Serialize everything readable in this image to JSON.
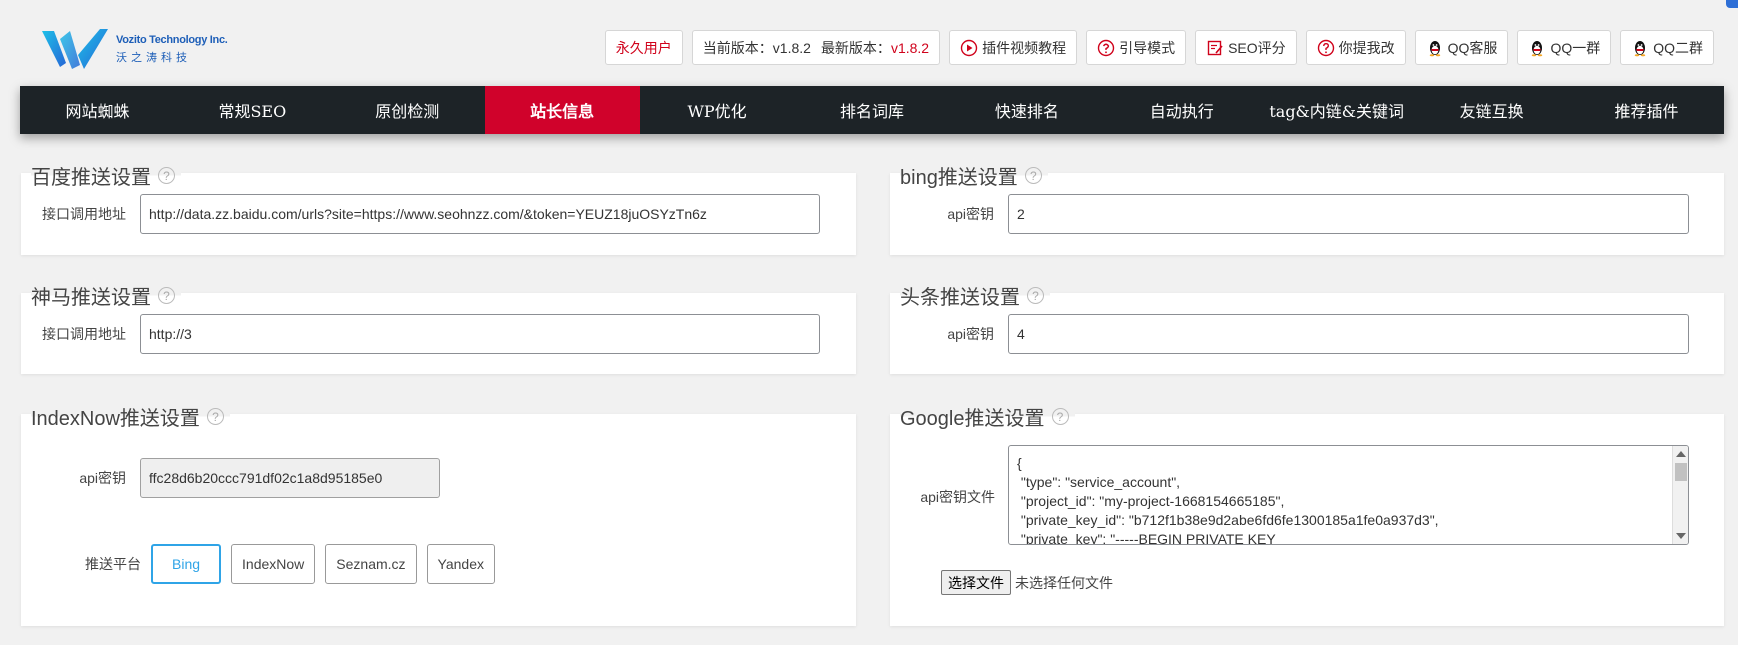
{
  "logo": {
    "name_en": "Vozito Technology Inc.",
    "name_cn": "沃之涛科技"
  },
  "topbar": {
    "license": "永久用户",
    "version_label": "当前版本：v1.8.2",
    "latest_label": "最新版本：",
    "latest_value": "v1.8.2",
    "video_tutorial": "插件视频教程",
    "guide_mode": "引导模式",
    "seo_score": "SEO评分",
    "feedback": "你提我改",
    "qq_service": "QQ客服",
    "qq_group1": "QQ一群",
    "qq_group2": "QQ二群"
  },
  "nav": [
    {
      "label": "网站蜘蛛"
    },
    {
      "label": "常规SEO"
    },
    {
      "label": "原创检测"
    },
    {
      "label": "站长信息",
      "active": true
    },
    {
      "label": "WP优化"
    },
    {
      "label": "排名词库"
    },
    {
      "label": "快速排名"
    },
    {
      "label": "自动执行"
    },
    {
      "label": "tag&内链&关键词"
    },
    {
      "label": "友链互换"
    },
    {
      "label": "推荐插件"
    }
  ],
  "baidu": {
    "title": "百度推送设置",
    "label": "接口调用地址",
    "value": "http://data.zz.baidu.com/urls?site=https://www.seohnzz.com/&token=YEUZ18juOSYzTn6z"
  },
  "bing": {
    "title": "bing推送设置",
    "label": "api密钥",
    "value": "2"
  },
  "shenma": {
    "title": "神马推送设置",
    "label": "接口调用地址",
    "value": "http://3"
  },
  "toutiao": {
    "title": "头条推送设置",
    "label": "api密钥",
    "value": "4"
  },
  "indexnow": {
    "title": "IndexNow推送设置",
    "label": "api密钥",
    "value": "ffc28d6b20ccc791df02c1a8d95185e0",
    "platform_label": "推送平台",
    "platforms": [
      "Bing",
      "IndexNow",
      "Seznam.cz",
      "Yandex"
    ]
  },
  "google": {
    "title": "Google推送设置",
    "label": "api密钥文件",
    "json_text": "{\n \"type\": \"service_account\",\n \"project_id\": \"my-project-1668154665185\",\n \"private_key_id\": \"b712f1b38e9d2abe6fd6fe1300185a1fe0a937d3\",\n \"private_key\": \"-----BEGIN PRIVATE KEY",
    "file_button": "选择文件",
    "file_status": "未选择任何文件"
  },
  "help_icon": "?"
}
